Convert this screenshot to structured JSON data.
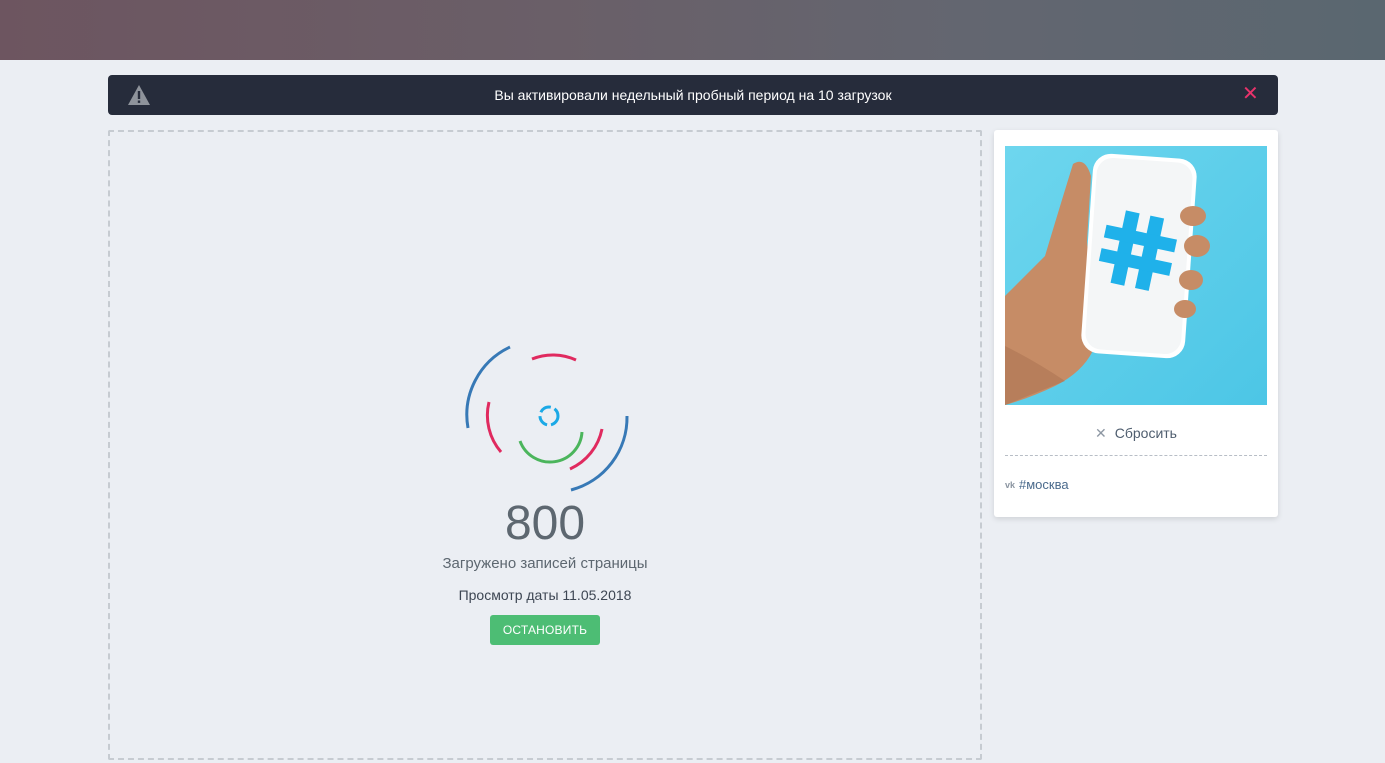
{
  "alert": {
    "message": "Вы активировали недельный пробный период на 10 загрузок",
    "icon": "warning-icon",
    "close_icon": "close-icon",
    "close_color": "#e8336b"
  },
  "progress": {
    "count": "800",
    "subtitle": "Загружено записей страницы",
    "date_text": "Просмотр даты 11.05.2018",
    "stop_label": "ОСТАНОВИТЬ"
  },
  "sidebar_card": {
    "reset_label": "Сбросить",
    "hashtag": "#москва",
    "network_icon": "vk-icon"
  },
  "colors": {
    "accent_green": "#4dbd74",
    "alert_bg": "#262c3b",
    "loader_blue": "#3779b6",
    "loader_red": "#e02a5f",
    "loader_green": "#4bb55c",
    "loader_cyan": "#1ba9e6"
  }
}
